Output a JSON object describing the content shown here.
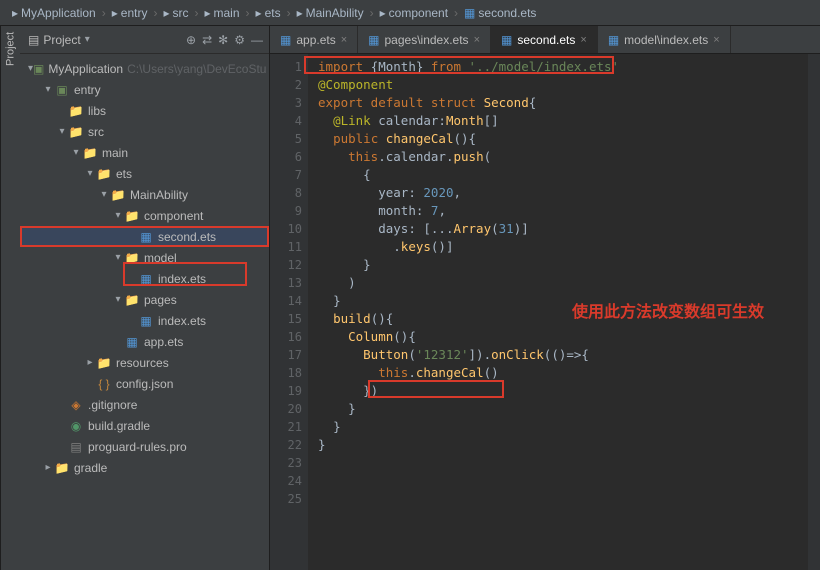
{
  "breadcrumb": [
    "MyApplication",
    "entry",
    "src",
    "main",
    "ets",
    "MainAbility",
    "component",
    "second.ets"
  ],
  "sidebarTab": "Project",
  "sideHeader": "Project",
  "sideIcons": [
    "⊕",
    "⇄",
    "✻",
    "⚙",
    "—"
  ],
  "tree": [
    {
      "d": 0,
      "a": "▾",
      "i": "mod",
      "label": "MyApplication",
      "extra": "C:\\Users\\yang\\DevEcoStu"
    },
    {
      "d": 1,
      "a": "▾",
      "i": "mod",
      "label": "entry"
    },
    {
      "d": 2,
      "a": "",
      "i": "folder",
      "label": "libs"
    },
    {
      "d": 2,
      "a": "▾",
      "i": "folder",
      "label": "src"
    },
    {
      "d": 3,
      "a": "▾",
      "i": "folder",
      "label": "main"
    },
    {
      "d": 4,
      "a": "▾",
      "i": "folder",
      "label": "ets"
    },
    {
      "d": 5,
      "a": "▾",
      "i": "folder",
      "label": "MainAbility"
    },
    {
      "d": 6,
      "a": "▾",
      "i": "folder",
      "label": "component"
    },
    {
      "d": 7,
      "a": "",
      "i": "etsf",
      "label": "second.ets",
      "sel": true
    },
    {
      "d": 6,
      "a": "▾",
      "i": "folder",
      "label": "model"
    },
    {
      "d": 7,
      "a": "",
      "i": "etsf",
      "label": "index.ets"
    },
    {
      "d": 6,
      "a": "▾",
      "i": "folder",
      "label": "pages"
    },
    {
      "d": 7,
      "a": "",
      "i": "etsf",
      "label": "index.ets"
    },
    {
      "d": 6,
      "a": "",
      "i": "etsf",
      "label": "app.ets"
    },
    {
      "d": 4,
      "a": "▸",
      "i": "folder",
      "label": "resources"
    },
    {
      "d": 4,
      "a": "",
      "i": "jsonf",
      "label": "config.json"
    },
    {
      "d": 2,
      "a": "",
      "i": "git",
      "label": ".gitignore"
    },
    {
      "d": 2,
      "a": "",
      "i": "gradlef",
      "label": "build.gradle"
    },
    {
      "d": 2,
      "a": "",
      "i": "pro",
      "label": "proguard-rules.pro"
    },
    {
      "d": 1,
      "a": "▸",
      "i": "folder",
      "label": "gradle"
    }
  ],
  "tabs": [
    {
      "label": "app.ets",
      "active": false
    },
    {
      "label": "pages\\index.ets",
      "active": false
    },
    {
      "label": "second.ets",
      "active": true
    },
    {
      "label": "model\\index.ets",
      "active": false
    }
  ],
  "code": [
    [
      [
        "kw",
        "import "
      ],
      [
        "punct",
        "{"
      ],
      [
        "id",
        "Month"
      ],
      [
        "punct",
        "}"
      ],
      [
        "kw",
        " from "
      ],
      [
        "str",
        "'../model/index.ets'"
      ]
    ],
    [
      [
        "ann",
        "@Component"
      ]
    ],
    [
      [
        "kw",
        "export default struct "
      ],
      [
        "type",
        "Second"
      ],
      [
        "punct",
        "{"
      ]
    ],
    [
      [
        "default",
        "  "
      ],
      [
        "ann",
        "@Link"
      ],
      [
        "default",
        " calendar:"
      ],
      [
        "type",
        "Month"
      ],
      [
        "punct",
        "[]"
      ]
    ],
    [
      [
        "default",
        "  "
      ],
      [
        "kw",
        "public "
      ],
      [
        "fn",
        "changeCal"
      ],
      [
        "punct",
        "(){"
      ]
    ],
    [
      [
        "default",
        "    "
      ],
      [
        "kw",
        "this"
      ],
      [
        "punct",
        "."
      ],
      [
        "id",
        "calendar"
      ],
      [
        "punct",
        "."
      ],
      [
        "fn",
        "push"
      ],
      [
        "punct",
        "("
      ]
    ],
    [
      [
        "default",
        "      "
      ],
      [
        "punct",
        "{"
      ]
    ],
    [
      [
        "default",
        "        "
      ],
      [
        "id",
        "year"
      ],
      [
        "punct",
        ": "
      ],
      [
        "num",
        "2020"
      ],
      [
        "punct",
        ","
      ]
    ],
    [
      [
        "default",
        "        "
      ],
      [
        "id",
        "month"
      ],
      [
        "punct",
        ": "
      ],
      [
        "num",
        "7"
      ],
      [
        "punct",
        ","
      ]
    ],
    [
      [
        "default",
        "        "
      ],
      [
        "id",
        "days"
      ],
      [
        "punct",
        ": [..."
      ],
      [
        "type",
        "Array"
      ],
      [
        "punct",
        "("
      ],
      [
        "num",
        "31"
      ],
      [
        "punct",
        ")]"
      ]
    ],
    [
      [
        "default",
        "          ."
      ],
      [
        "fn",
        "keys"
      ],
      [
        "punct",
        "()]"
      ]
    ],
    [
      [
        "default",
        "      "
      ],
      [
        "punct",
        "}"
      ]
    ],
    [
      [
        "default",
        "    "
      ],
      [
        "punct",
        ")"
      ]
    ],
    [
      [
        "default",
        "  "
      ],
      [
        "punct",
        "}"
      ]
    ],
    [
      [
        "default",
        ""
      ]
    ],
    [
      [
        "default",
        "  "
      ],
      [
        "fn",
        "build"
      ],
      [
        "punct",
        "(){"
      ]
    ],
    [
      [
        "default",
        "    "
      ],
      [
        "type",
        "Column"
      ],
      [
        "punct",
        "(){"
      ]
    ],
    [
      [
        "default",
        "      "
      ],
      [
        "type",
        "Button"
      ],
      [
        "punct",
        "("
      ],
      [
        "str",
        "'12312'"
      ],
      [
        "punct",
        "])."
      ],
      [
        "fn",
        "onClick"
      ],
      [
        "punct",
        "(()=>{"
      ]
    ],
    [
      [
        "default",
        "        "
      ],
      [
        "kw",
        "this"
      ],
      [
        "punct",
        "."
      ],
      [
        "fn",
        "changeCal"
      ],
      [
        "punct",
        "()"
      ]
    ],
    [
      [
        "default",
        "      "
      ],
      [
        "punct",
        "})"
      ]
    ],
    [
      [
        "default",
        "    "
      ],
      [
        "punct",
        "}"
      ]
    ],
    [
      [
        "default",
        "  "
      ],
      [
        "punct",
        "}"
      ]
    ],
    [
      [
        "default",
        ""
      ]
    ],
    [
      [
        "default",
        ""
      ]
    ],
    [
      [
        "punct",
        "}"
      ]
    ]
  ],
  "annotation": "使用此方法改变数组可生效"
}
